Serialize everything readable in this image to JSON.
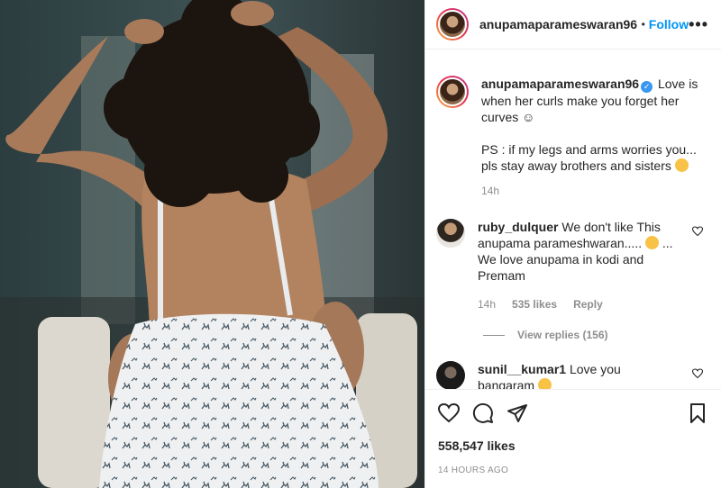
{
  "post": {
    "username": "anupamaparameswaran96",
    "header_username": "anupamaparameswaran96",
    "follow_label": "Follow",
    "dot": "•",
    "more_label": "•••"
  },
  "caption": {
    "username": "anupamaparameswaran96",
    "text": "Love is when her curls make you forget her curves",
    "ps": "PS : if my legs and arms worries you... pls stay away brothers and sisters",
    "time": "14h"
  },
  "comments": [
    {
      "username": "ruby_dulquer",
      "text": "We don't like This anupama parameshwaran.....",
      "text2": "...",
      "text3": "We love anupama in kodi and Premam",
      "time": "14h",
      "likes": "535 likes",
      "reply": "Reply",
      "view_replies": "View replies (156)"
    },
    {
      "username": "sunil__kumar1",
      "text": "Love you bangaram"
    }
  ],
  "footer": {
    "likes": "558,547 likes",
    "ago": "14 HOURS AGO"
  },
  "icons": {
    "like": "heart-icon",
    "comment": "comment-icon",
    "share": "send-icon",
    "save": "bookmark-icon"
  },
  "colors": {
    "accent": "#0095f6",
    "muted": "#8e8e8e",
    "text": "#262626"
  }
}
